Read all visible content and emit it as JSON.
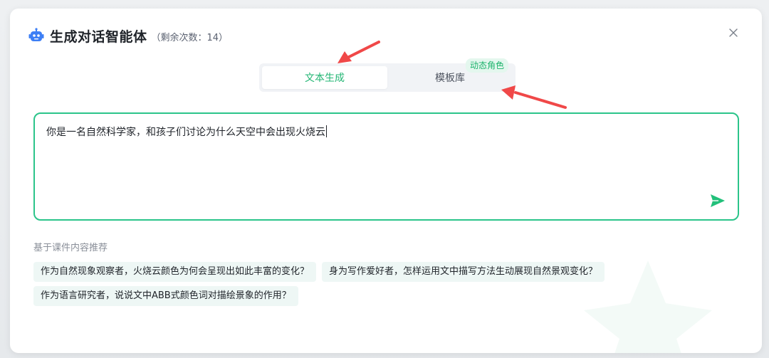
{
  "dialog": {
    "title": "生成对话智能体",
    "remaining": "（剩余次数：14）",
    "icon": "robot-icon",
    "close_icon": "close-icon"
  },
  "tabs": [
    {
      "label": "文本生成",
      "active": true
    },
    {
      "label": "模板库",
      "active": false,
      "badge": "动态角色"
    }
  ],
  "prompt": {
    "value": "你是一名自然科学家，和孩子们讨论为什么天空中会出现火烧云",
    "send_icon": "send-icon"
  },
  "recommend": {
    "label": "基于课件内容推荐",
    "items": [
      "作为自然现象观察者，火烧云颜色为何会呈现出如此丰富的变化？",
      "身为写作爱好者，怎样运用文中描写方法生动展现自然景观变化？",
      "作为语言研究者，说说文中ABB式颜色词对描绘景象的作用？"
    ]
  },
  "colors": {
    "accent": "#22b573",
    "border_accent": "#2bc48a",
    "arrow": "#f04848",
    "chip_bg": "#eef7f5",
    "icon_blue": "#3d7ff5"
  }
}
